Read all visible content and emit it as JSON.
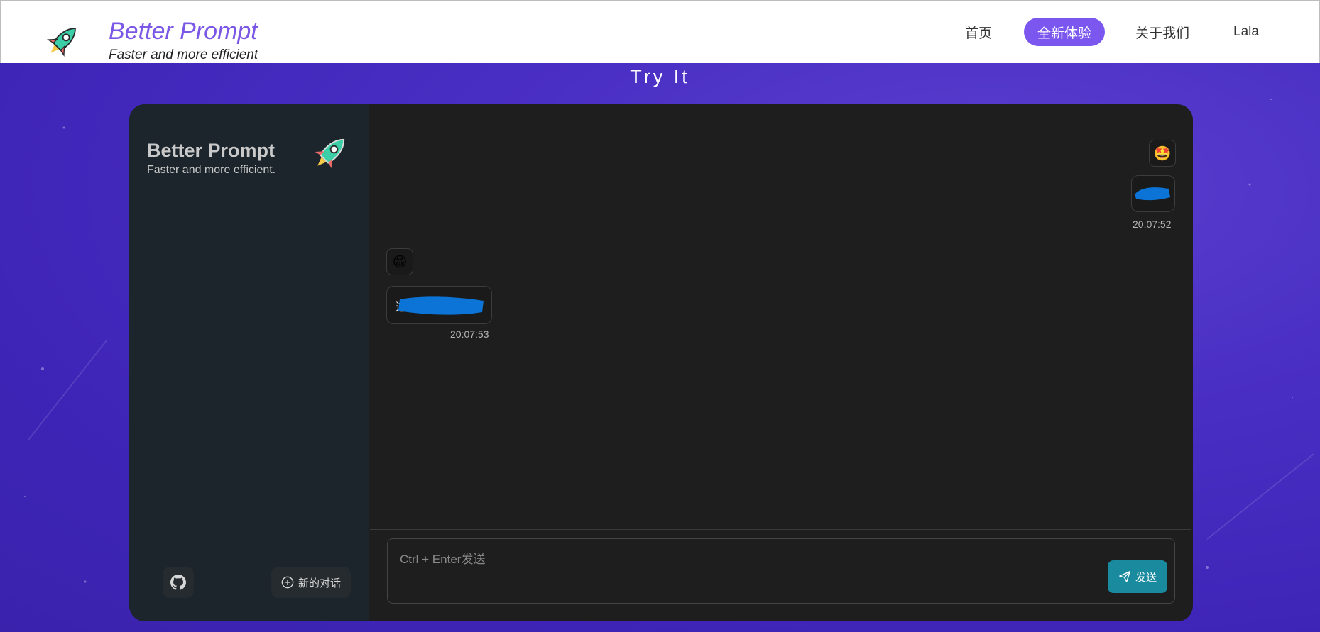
{
  "header": {
    "brand_title": "Better Prompt",
    "brand_subtitle": "Faster and more efficient",
    "nav": [
      {
        "label": "首页",
        "active": false
      },
      {
        "label": "全新体验",
        "active": true
      },
      {
        "label": "关于我们",
        "active": false
      },
      {
        "label": "Lala",
        "active": false
      }
    ],
    "accent_color": "#7b57f0"
  },
  "page_heading": "Try It",
  "sidebar": {
    "title": "Better Prompt",
    "subtitle": "Faster and more efficient.",
    "github_icon": "github-icon",
    "new_chat_label": "新的对话"
  },
  "messages": [
    {
      "role": "user",
      "avatar": "🤩",
      "text": "",
      "time": "20:07:52",
      "redacted": true
    },
    {
      "role": "assistant",
      "avatar": "😁",
      "text": "这",
      "time": "20:07:53",
      "redacted": true
    }
  ],
  "composer": {
    "placeholder": "Ctrl + Enter发送",
    "send_label": "发送",
    "send_color": "#1a8a9f"
  }
}
